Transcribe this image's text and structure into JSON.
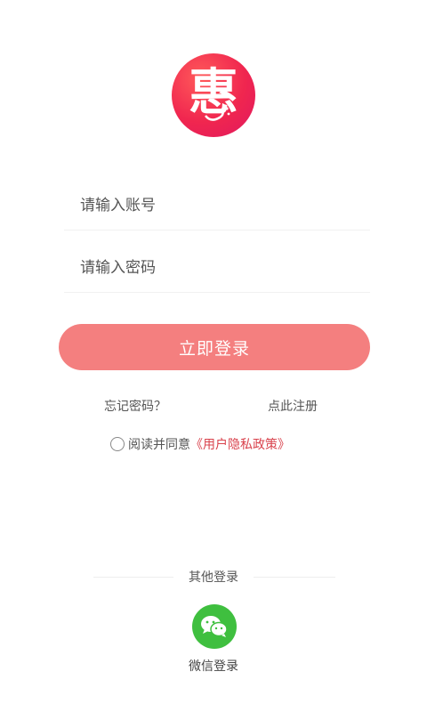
{
  "logo": {
    "char": "惠"
  },
  "form": {
    "account_placeholder": "请输入账号",
    "password_placeholder": "请输入密码"
  },
  "actions": {
    "login_label": "立即登录",
    "forgot_label": "忘记密码？",
    "register_label": "点此注册"
  },
  "agreement": {
    "prefix": "阅读并同意",
    "policy_label": "《用户隐私政策》"
  },
  "other_login": {
    "title": "其他登录",
    "wechat_label": "微信登录"
  },
  "colors": {
    "accent": "#f47f7f",
    "policy": "#d9434d",
    "wechat": "#3fbf3f"
  }
}
